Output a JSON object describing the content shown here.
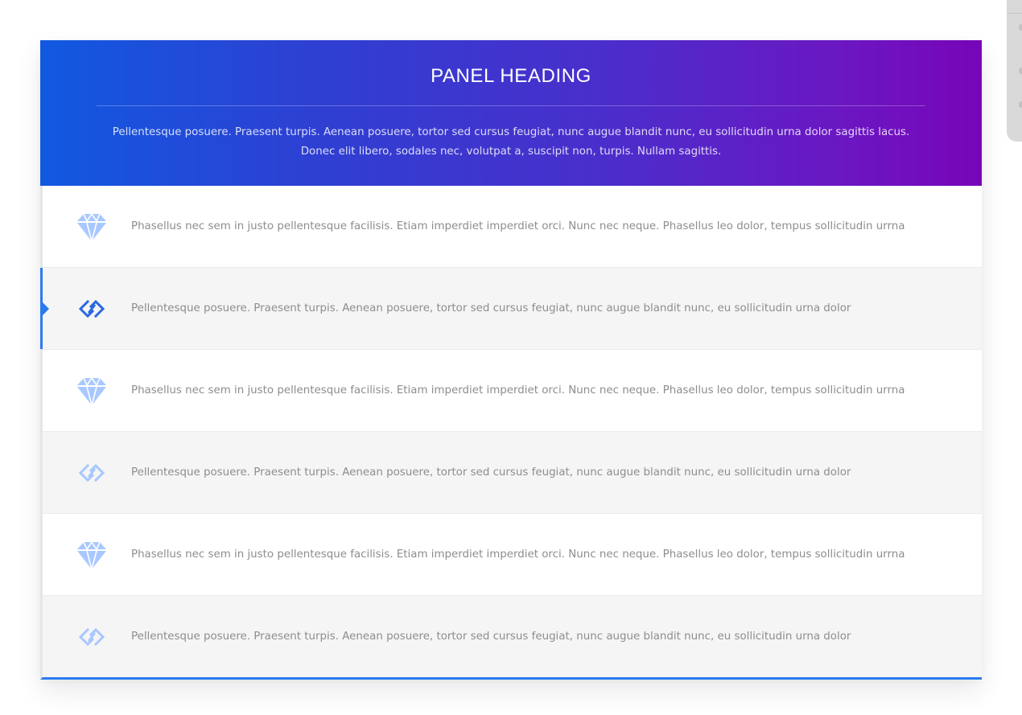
{
  "panel": {
    "title": "PANEL HEADING",
    "intro": "Pellentesque posuere. Praesent turpis. Aenean posuere, tortor sed cursus feugiat, nunc augue blandit nunc, eu sollicitudin urna dolor sagittis lacus. Donec elit libero, sodales nec, volutpat a, suscipit non, turpis. Nullam sagittis."
  },
  "items": [
    {
      "icon": "diamond-icon",
      "text": "Phasellus nec sem in justo pellentesque facilisis. Etiam imperdiet imperdiet orci. Nunc nec neque. Phasellus leo dolor, tempus sollicitudin urrna",
      "active": false
    },
    {
      "icon": "link-icon",
      "text": "Pellentesque posuere. Praesent turpis. Aenean posuere, tortor sed cursus feugiat, nunc augue blandit nunc, eu sollicitudin urna dolor",
      "active": true
    },
    {
      "icon": "diamond-icon",
      "text": "Phasellus nec sem in justo pellentesque facilisis. Etiam imperdiet imperdiet orci. Nunc nec neque. Phasellus leo dolor, tempus sollicitudin urrna",
      "active": false
    },
    {
      "icon": "link-icon",
      "text": "Pellentesque posuere. Praesent turpis. Aenean posuere, tortor sed cursus feugiat, nunc augue blandit nunc, eu sollicitudin urna dolor",
      "active": false
    },
    {
      "icon": "diamond-icon",
      "text": "Phasellus nec sem in justo pellentesque facilisis. Etiam imperdiet imperdiet orci. Nunc nec neque. Phasellus leo dolor, tempus sollicitudin urrna",
      "active": false
    },
    {
      "icon": "link-icon",
      "text": "Pellentesque posuere. Praesent turpis. Aenean posuere, tortor sed cursus feugiat, nunc augue blandit nunc, eu sollicitudin urna dolor",
      "active": false
    }
  ],
  "colors": {
    "accent": "#2b7bef",
    "icon_light": "#a8c8ff",
    "icon_active": "#2b68e0",
    "header_gradient_start": "#1159e0",
    "header_gradient_end": "#7705b8"
  }
}
